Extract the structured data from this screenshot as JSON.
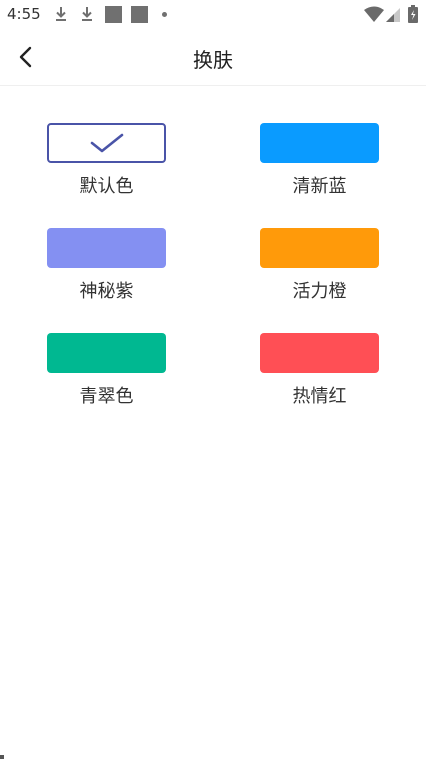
{
  "status_bar": {
    "time": "4:55",
    "icons": [
      "download-icon",
      "download-icon",
      "notification-square-icon",
      "notification-square-icon",
      "dot-icon",
      "wifi-icon",
      "signal-icon",
      "battery-icon"
    ]
  },
  "nav": {
    "back_icon": "chevron-left-icon",
    "title": "换肤"
  },
  "themes": [
    {
      "label": "默认色",
      "color": "#ffffff",
      "border": "#4a54a8",
      "selected": true,
      "icon": "check-icon"
    },
    {
      "label": "清新蓝",
      "color": "#0a9bff",
      "selected": false
    },
    {
      "label": "神秘紫",
      "color": "#8490f2",
      "selected": false
    },
    {
      "label": "活力橙",
      "color": "#ff9a0a",
      "selected": false
    },
    {
      "label": "青翠色",
      "color": "#00b891",
      "selected": false
    },
    {
      "label": "热情红",
      "color": "#ff4f55",
      "selected": false
    }
  ]
}
